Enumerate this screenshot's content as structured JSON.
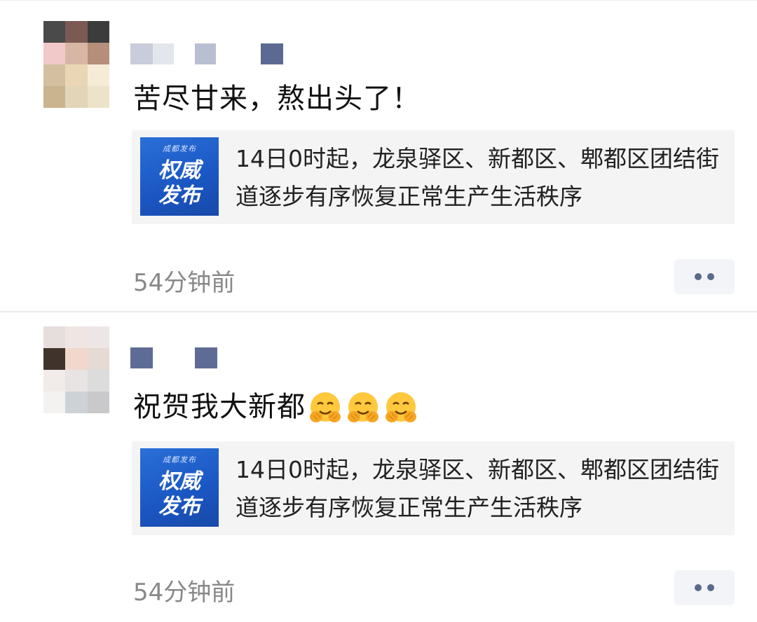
{
  "posts": [
    {
      "text": "苦尽甘来，熬出头了！",
      "emojis": [],
      "link": {
        "thumb_small": "成都发布",
        "thumb_line1": "权威",
        "thumb_line2": "发布",
        "title": "14日0时起，龙泉驿区、新都区、郫都区团结街道逐步有序恢复正常生产生活秩序"
      },
      "time": "54分钟前"
    },
    {
      "text": "祝贺我大新都",
      "emojis": [
        "hug-emoji",
        "hug-emoji",
        "hug-emoji"
      ],
      "link": {
        "thumb_small": "成都发布",
        "thumb_line1": "权威",
        "thumb_line2": "发布",
        "title": "14日0时起，龙泉驿区、新都区、郫都区团结街道逐步有序恢复正常生产生活秩序"
      },
      "time": "54分钟前"
    }
  ],
  "icons": {
    "more": "more-dots-icon",
    "emoji": "hug-emoji"
  },
  "colors": {
    "link_dot": "#5a6a8c",
    "thumb_blue": "#1a56c2",
    "time_gray": "#888888",
    "card_bg": "#f4f4f4"
  }
}
